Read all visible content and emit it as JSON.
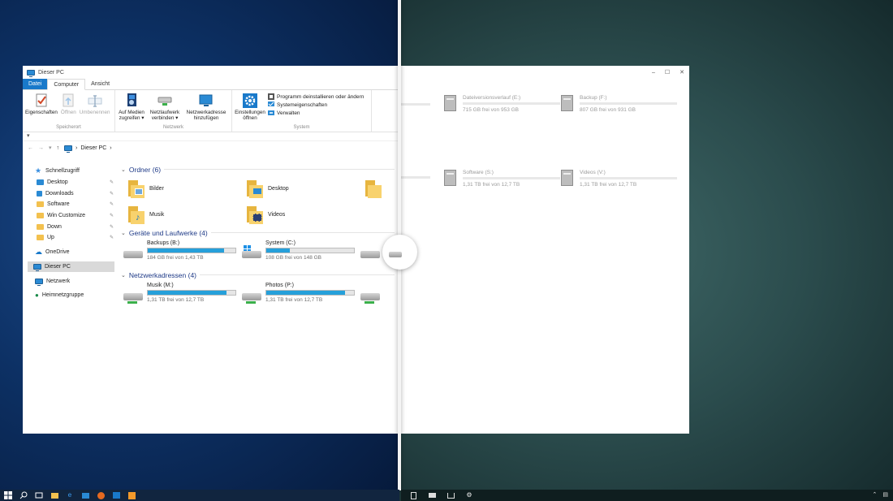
{
  "window": {
    "title": "Dieser PC"
  },
  "tabs": [
    {
      "label": "Datei"
    },
    {
      "label": "Computer"
    },
    {
      "label": "Ansicht"
    }
  ],
  "ribbon": {
    "speicherort": {
      "label": "Speicherort",
      "buttons": [
        {
          "label": "Eigenschaften",
          "icon": "properties-icon",
          "enabled": true
        },
        {
          "label": "Öffnen",
          "icon": "open-icon",
          "enabled": false
        },
        {
          "label": "Umbenennen",
          "icon": "rename-icon",
          "enabled": false
        }
      ]
    },
    "netzwerk": {
      "label": "Netzwerk",
      "buttons": [
        {
          "label": "Auf Medien zugreifen ▾",
          "icon": "media-access-icon"
        },
        {
          "label": "Netzlaufwerk verbinden ▾",
          "icon": "map-network-drive-icon"
        },
        {
          "label": "Netzwerkadresse hinzufügen",
          "icon": "add-network-location-icon"
        }
      ]
    },
    "system": {
      "label": "System",
      "big_button": {
        "label": "Einstellungen öffnen",
        "icon": "settings-gear-icon"
      },
      "small_buttons": [
        {
          "label": "Programm deinstallieren oder ändern",
          "icon": "uninstall-icon"
        },
        {
          "label": "Systemeigenschaften",
          "icon": "system-properties-icon"
        },
        {
          "label": "Verwalten",
          "icon": "manage-icon"
        }
      ]
    }
  },
  "qat": {
    "symbol": "▾"
  },
  "address": {
    "nav": [
      "←",
      "→",
      "▾",
      "↑"
    ],
    "path": "Dieser PC",
    "sep": "›"
  },
  "nav": {
    "quick_access": "Schnellzugriff",
    "pinned": [
      {
        "label": "Desktop"
      },
      {
        "label": "Downloads"
      },
      {
        "label": "Software"
      },
      {
        "label": "Win Customize"
      },
      {
        "label": "Down"
      },
      {
        "label": "Up"
      }
    ],
    "onedrive": "OneDrive",
    "this_pc": "Dieser PC",
    "network": "Netzwerk",
    "homegroup": "Heimnetzgruppe"
  },
  "sections": {
    "folders": "Ordner (6)",
    "devices": "Geräte und Laufwerke (4)",
    "network": "Netzwerkadressen (4)"
  },
  "folders": [
    {
      "label": "Bilder",
      "icon": "pictures-folder-icon"
    },
    {
      "label": "Desktop",
      "icon": "desktop-folder-icon"
    },
    {
      "label": "Musik",
      "icon": "music-folder-icon"
    },
    {
      "label": "Videos",
      "icon": "videos-folder-icon"
    }
  ],
  "drives": [
    {
      "name": "Backups (B:)",
      "free": "184 GB frei von 1,43 TB",
      "used": 0.87,
      "type": "hdd"
    },
    {
      "name": "System (C:)",
      "free": "108 GB frei von 148 GB",
      "used": 0.27,
      "type": "windows"
    }
  ],
  "network_drives": [
    {
      "name": "Musik (M:)",
      "free": "1,31 TB frei von 12,7 TB",
      "used": 0.9
    },
    {
      "name": "Photos (P:)",
      "free": "1,31 TB frei von 12,7 TB",
      "used": 0.9
    }
  ],
  "right_window": {
    "controls": [
      "–",
      "☐",
      "✕"
    ],
    "drives": [
      {
        "name": "Dateiversionsverlauf (E:)",
        "free": "715 GB frei von 953 GB"
      },
      {
        "name": "Backup (F:)",
        "free": "807 GB frei von 931 GB"
      },
      {
        "name": "Software (S:)",
        "free": "1,31 TB frei von 12,7 TB"
      },
      {
        "name": "Videos (V:)",
        "free": "1,31 TB frei von 12,7 TB"
      }
    ]
  },
  "colors": {
    "accent": "#1979ca",
    "bar": "#26a0da",
    "section": "#1e3a87"
  }
}
